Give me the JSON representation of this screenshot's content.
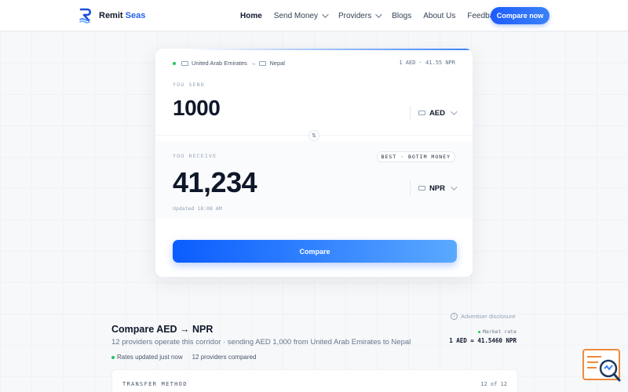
{
  "nav": {
    "logo_text_main": "Remit",
    "logo_text_accent": "Seas",
    "links": [
      {
        "label": "Home",
        "dropdown": false,
        "active": true
      },
      {
        "label": "Send Money",
        "dropdown": true,
        "active": false
      },
      {
        "label": "Providers",
        "dropdown": true,
        "active": false
      },
      {
        "label": "Blogs",
        "dropdown": false,
        "active": false
      },
      {
        "label": "About Us",
        "dropdown": false,
        "active": false
      },
      {
        "label": "Feedback",
        "dropdown": false,
        "active": false
      }
    ],
    "cta_label": "Compare now"
  },
  "converter": {
    "from_country": "United Arab Emirates",
    "to_country": "Nepal",
    "arrow": "→",
    "rate_summary": "1 AED · 41.55 NPR",
    "send_label": "YOU SEND",
    "send_amount": "1000",
    "send_currency": "AED",
    "receive_label": "YOU RECEIVE",
    "best_badge": "BEST · BOTIM MONEY",
    "receive_amount": "41,234",
    "receive_currency": "NPR",
    "updated_text": "Updated 18:08 AM",
    "swap_symbol": "⇅",
    "compare_label": "Compare"
  },
  "results": {
    "disclosure_label": "Advertiser disclosure",
    "title": "Compare AED → NPR",
    "subtitle": "12 providers operate this corridor · sending AED 1,000 from United Arab Emirates to Nepal",
    "status_updated": "Rates updated just now",
    "status_count": "12 providers compared",
    "market_label": "Market rate",
    "market_value": "1 AED = 41.5460 NPR",
    "table_header_left": "TRANSFER METHOD",
    "table_header_right": "12 of 12"
  },
  "colors": {
    "primary": "#2563eb",
    "status_green": "#22c55e",
    "fab_orange": "#f08a3c"
  },
  "icons": [
    "logo-mark-icon",
    "chevron-down-icon",
    "swap-icon",
    "info-icon",
    "chat-search-icon"
  ]
}
